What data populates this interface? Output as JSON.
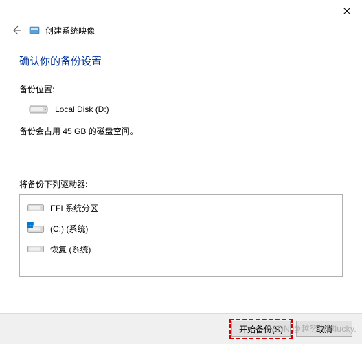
{
  "window": {
    "title": "创建系统映像"
  },
  "main": {
    "heading": "确认你的备份设置",
    "location_label": "备份位置:",
    "location_value": "Local Disk (D:)",
    "space_info": "备份会占用 45 GB 的磁盘空间。",
    "drives_label": "将备份下列驱动器:"
  },
  "drives": [
    {
      "label": "EFI 系统分区",
      "icon": "disk"
    },
    {
      "label": "(C:) (系统)",
      "icon": "windisk"
    },
    {
      "label": "恢复 (系统)",
      "icon": "disk"
    }
  ],
  "footer": {
    "start_label": "开始备份(S)",
    "cancel_label": "取消"
  },
  "watermark": "CSDN @越努力越lucky."
}
